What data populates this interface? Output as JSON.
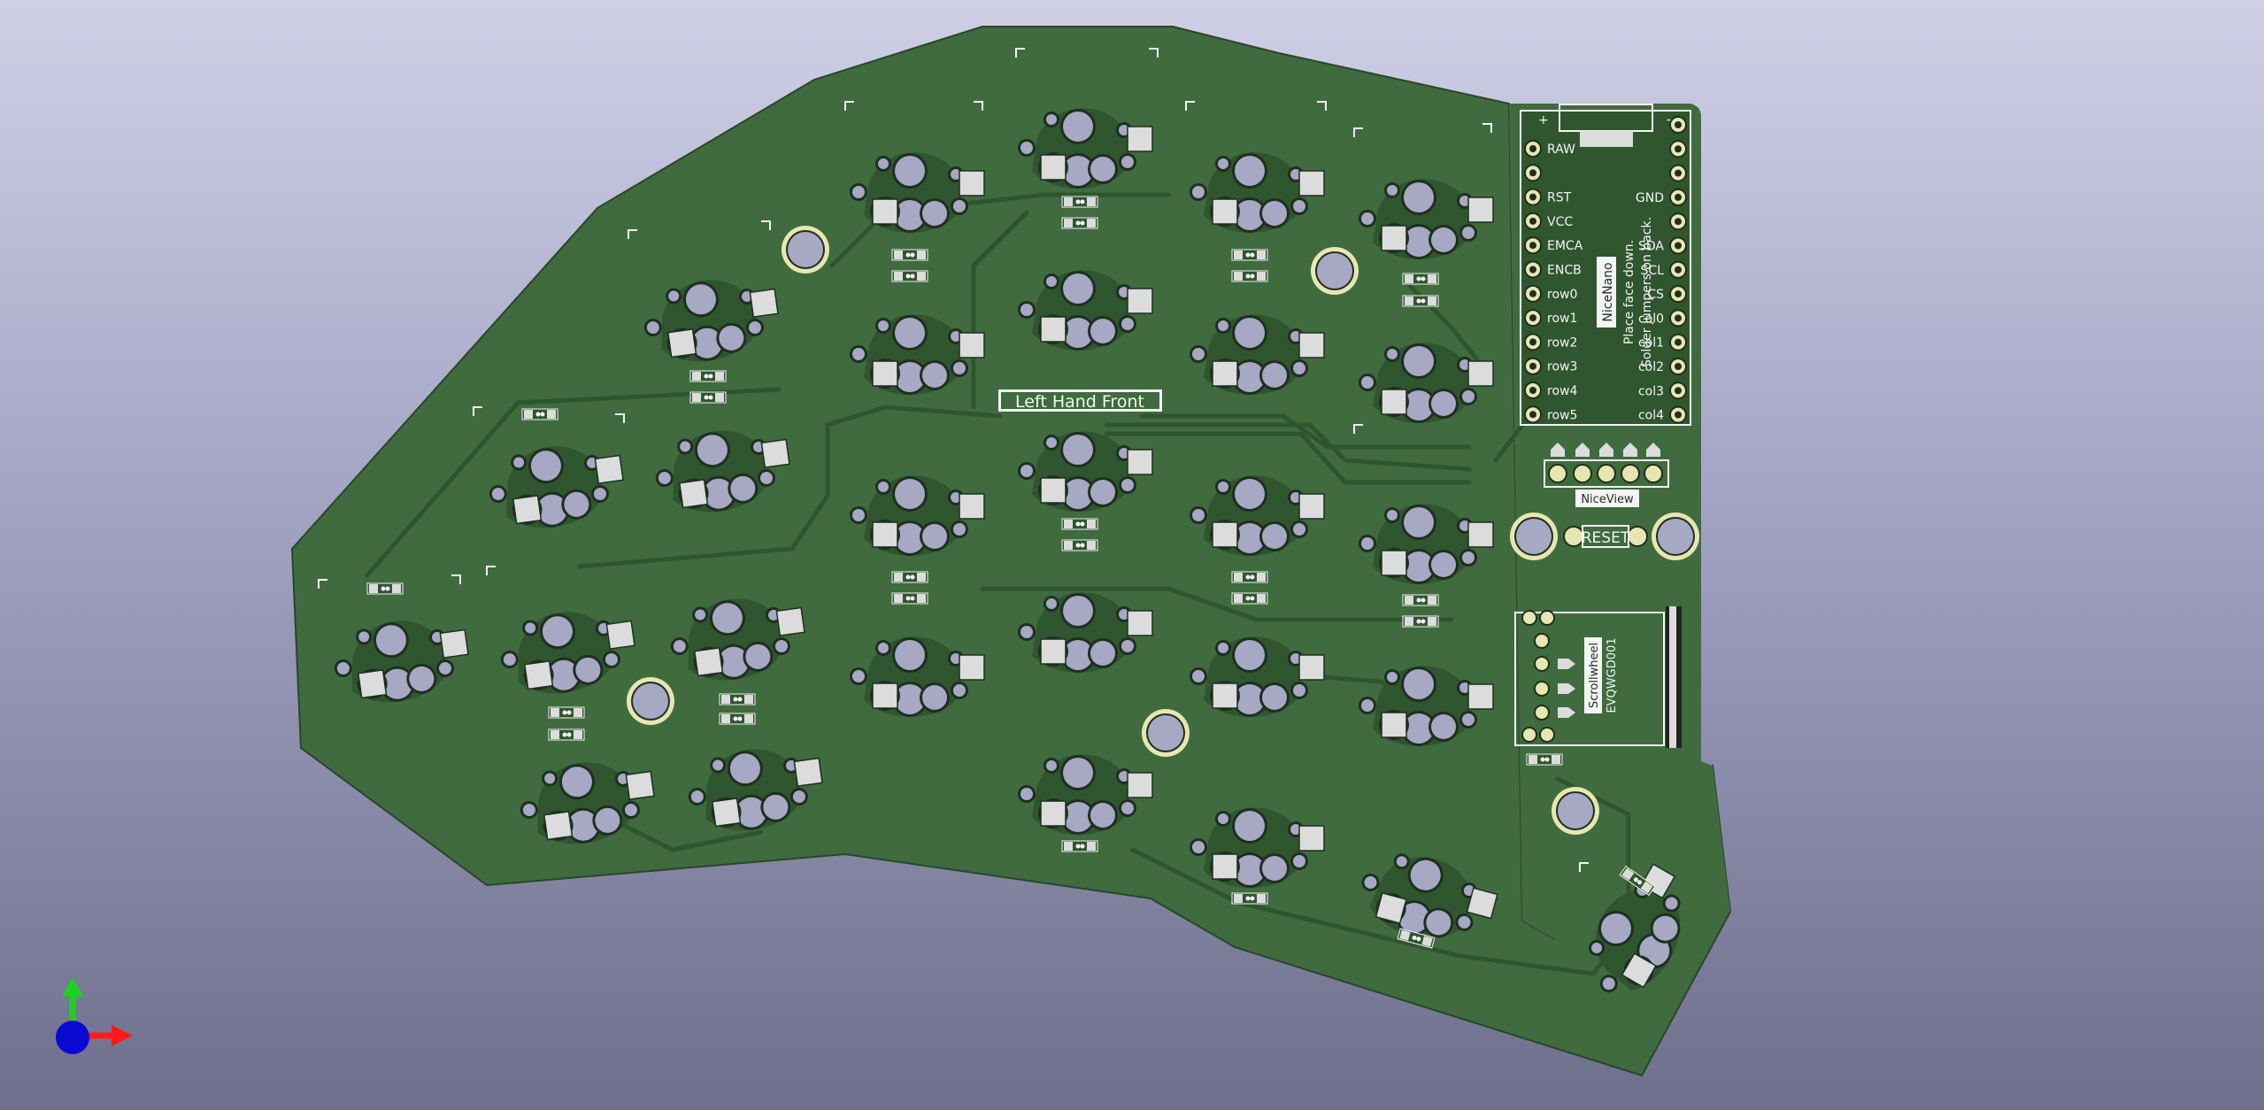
{
  "board": {
    "title": "Left Hand Front",
    "mcu_name": "NiceNano",
    "mcu_note_line1": "Place face down.",
    "mcu_note_line2": "Solder jumpers on back.",
    "mcu_left_pins": [
      "RAW",
      "",
      "RST",
      "VCC",
      "EMCA",
      "ENCB",
      "row0",
      "row1",
      "row2",
      "row3",
      "row4",
      "row5"
    ],
    "mcu_right_pins": [
      "",
      "",
      "",
      "GND",
      "",
      "SDA",
      "SCL",
      "CS",
      "col0",
      "col1",
      "col2",
      "col3",
      "col4"
    ],
    "display_label": "NiceView",
    "reset_label": "RESET",
    "encoder_label": "Scrollwheel",
    "encoder_part": "EVQWGD001"
  },
  "colors": {
    "background_top": "#cfd0e6",
    "background_bottom": "#6e6f8c",
    "pcb": "#3f6b3f",
    "trace": "#2f552f",
    "silkscreen": "#f4f4f4",
    "pad": "#dcdcdc",
    "hole": "#a6a8c4"
  },
  "axes_widget": {
    "x_color": "#ff1a1a",
    "y_color": "#1ed11e",
    "z_color": "#0a0ad0"
  }
}
